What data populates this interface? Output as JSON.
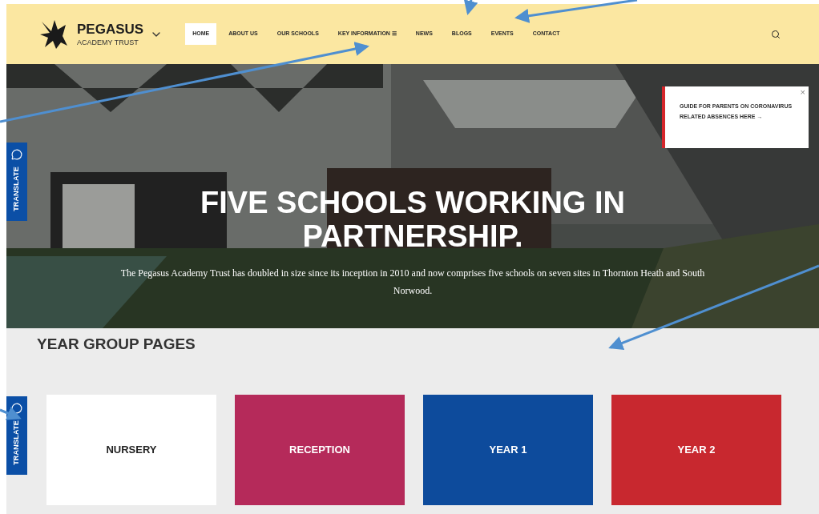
{
  "header": {
    "logo_title": "PEGASUS",
    "logo_subtitle": "ACADEMY TRUST",
    "nav": [
      {
        "label": "HOME",
        "selected": true
      },
      {
        "label": "ABOUT US",
        "selected": false
      },
      {
        "label": "OUR SCHOOLS",
        "selected": false
      },
      {
        "label": "KEY INFORMATION ☰",
        "selected": false
      },
      {
        "label": "NEWS",
        "selected": false
      },
      {
        "label": "BLOGS",
        "selected": false
      },
      {
        "label": "EVENTS",
        "selected": false
      },
      {
        "label": "CONTACT",
        "selected": false
      }
    ]
  },
  "hero": {
    "heading": "FIVE SCHOOLS WORKING IN PARTNERSHIP.",
    "text": "The Pegasus Academy Trust has doubled in size since its inception in 2010 and now comprises five schools on seven sites in Thornton Heath and South Norwood.",
    "notice": {
      "text": "GUIDE FOR PARENTS ON CORONAVIRUS RELATED ABSENCES HERE →",
      "close": "×"
    }
  },
  "translate_tabs": [
    "TRANSLATE",
    "TRANSLATE"
  ],
  "year_groups": {
    "title": "YEAR GROUP PAGES",
    "cards": [
      {
        "label": "NURSERY",
        "color": "#ffffff"
      },
      {
        "label": "RECEPTION",
        "color": "#b52a5a"
      },
      {
        "label": "YEAR 1",
        "color": "#0d4b9c"
      },
      {
        "label": "YEAR 2",
        "color": "#c8282f"
      }
    ]
  }
}
